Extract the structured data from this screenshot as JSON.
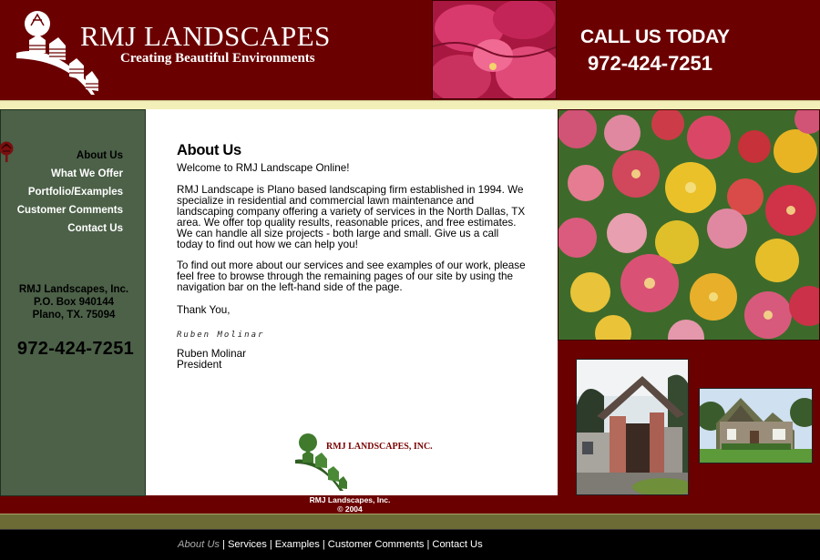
{
  "header": {
    "brand_title": "RMJ LANDSCAPES",
    "tagline": "Creating Beautiful Environments",
    "call_label": "CALL US TODAY",
    "call_phone": "972-424-7251"
  },
  "sidebar": {
    "nav": [
      {
        "label": "About Us",
        "active": true
      },
      {
        "label": "What We Offer",
        "active": false
      },
      {
        "label": "Portfolio/Examples",
        "active": false
      },
      {
        "label": "Customer Comments",
        "active": false
      },
      {
        "label": "Contact Us",
        "active": false
      }
    ],
    "address": {
      "company": "RMJ Landscapes, Inc.",
      "po_box": "P.O. Box 940144",
      "city": "Plano, TX. 75094"
    },
    "phone": "972-424-7251"
  },
  "content": {
    "title": "About Us",
    "welcome": "Welcome to RMJ Landscape Online!",
    "about": "RMJ Landscape is Plano based landscaping firm established in 1994. We specialize in residential and commercial lawn maintenance and landscaping company offering a variety of services in the North Dallas, TX area. We offer top quality results, reasonable prices, and free estimates. We can handle all size projects - both large and small. Give us a call today to find out how we can help you!",
    "more": "To find out more about our services and see examples of our work, please feel free to browse through the remaining pages of our site by using the navigation bar on the left-hand side of the page.",
    "thanks": "Thank You,",
    "signature": "Ruben Molinar",
    "name": "Ruben Molinar",
    "position": "President",
    "footer_logo_text": "RMJ LANDSCAPES, INC."
  },
  "footer": {
    "company": "RMJ Landscapes, Inc.",
    "copyright": "© 2004",
    "links": [
      {
        "label": "About Us",
        "active": true
      },
      {
        "label": "Services",
        "active": false
      },
      {
        "label": "Examples",
        "active": false
      },
      {
        "label": "Customer Comments",
        "active": false
      },
      {
        "label": "Contact Us",
        "active": false
      }
    ]
  },
  "colors": {
    "maroon": "#6b0000",
    "sidebar_green": "#4c6148",
    "olive": "#6c6b36",
    "cream_stripe": "#f2efb8"
  },
  "icons": {
    "logo": "tree-logo-icon",
    "nav_marker": "tree-icon"
  }
}
